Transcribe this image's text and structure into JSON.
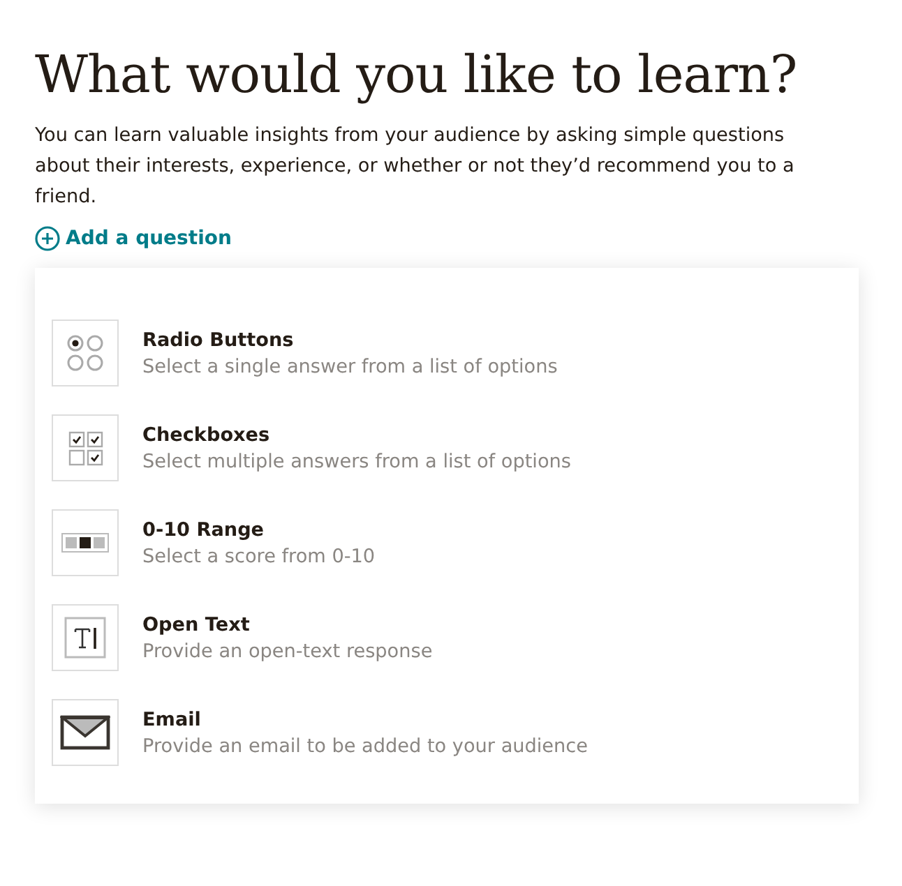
{
  "title": "What would you like to learn?",
  "intro": "You can learn valuable insights from your audience by asking simple questions about their interests, experience, or whether or not they’d recommend you to a friend.",
  "add_link": "Add a question",
  "question_types": [
    {
      "kind": "radio",
      "name": "Radio Buttons",
      "description": "Select a single answer from a list of options"
    },
    {
      "kind": "checkbox",
      "name": "Checkboxes",
      "description": "Select multiple answers from a list of options"
    },
    {
      "kind": "range",
      "name": "0-10 Range",
      "description": "Select a score from 0-10"
    },
    {
      "kind": "text",
      "name": "Open Text",
      "description": "Provide an open-text response"
    },
    {
      "kind": "email",
      "name": "Email",
      "description": "Provide an email to be added to your audience"
    }
  ]
}
